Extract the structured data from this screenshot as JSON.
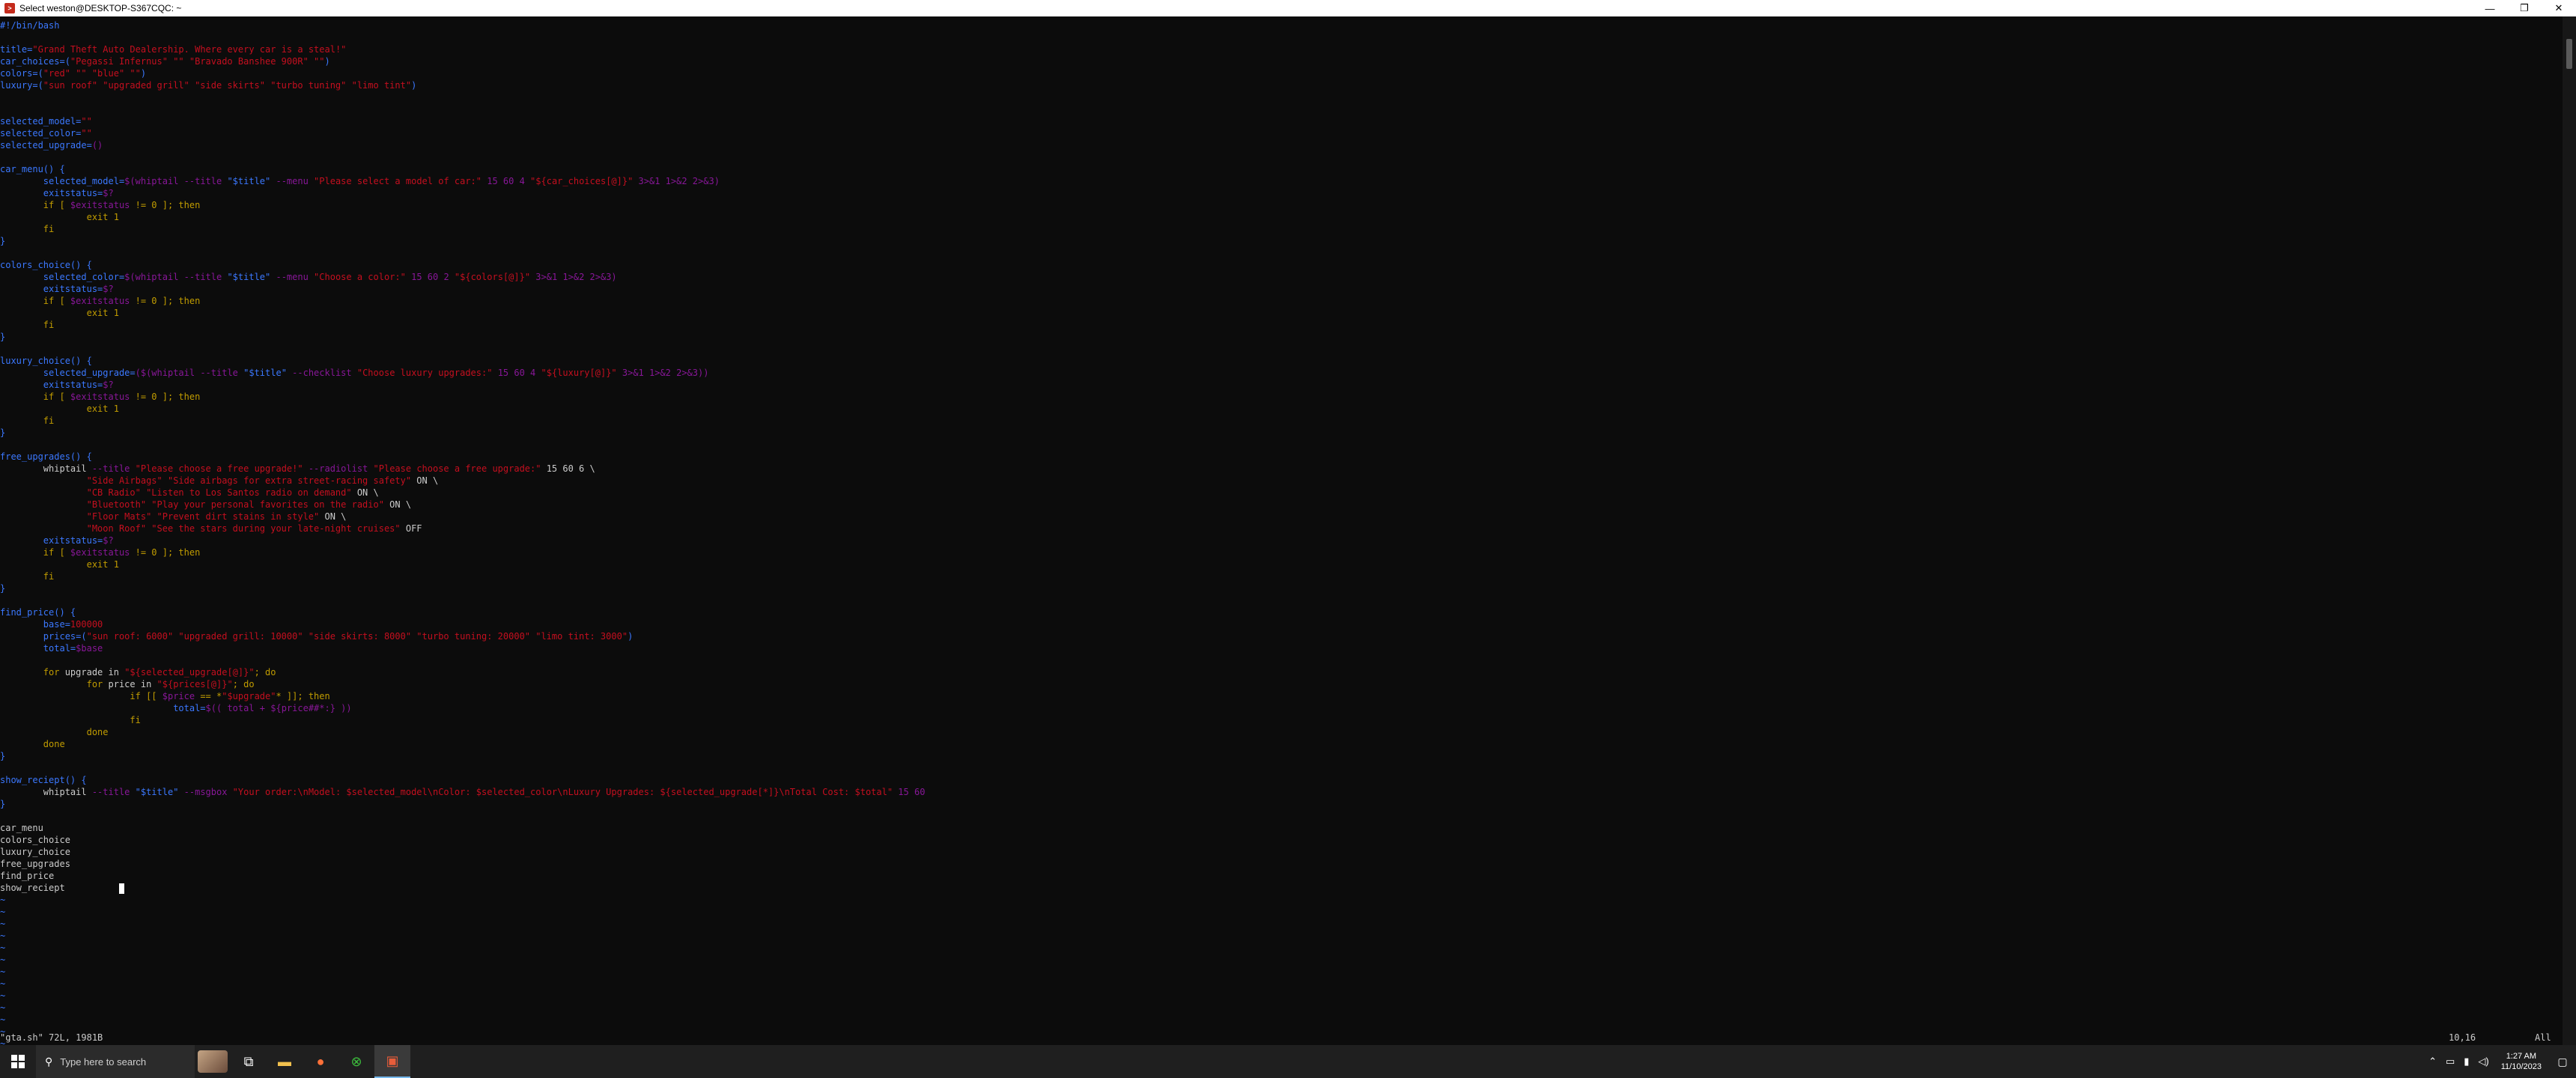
{
  "window": {
    "title": "Select weston@DESKTOP-S367CQC: ~",
    "controls": {
      "minimize": "—",
      "maximize": "❐",
      "close": "✕"
    }
  },
  "editor": {
    "lines": [
      [
        [
          "#!/bin/bash",
          "cmt"
        ]
      ],
      [
        [
          "",
          ""
        ]
      ],
      [
        [
          "title=",
          "var"
        ],
        [
          "\"Grand Theft Auto Dealership. Where every car is a steal!\"",
          "str"
        ]
      ],
      [
        [
          "car_choices=(",
          "var"
        ],
        [
          "\"Pegassi Infernus\" \"\" \"Bravado Banshee 900R\" \"\"",
          "str"
        ],
        [
          ")",
          "var"
        ]
      ],
      [
        [
          "colors=(",
          "var"
        ],
        [
          "\"red\" \"\" \"blue\" \"\"",
          "str"
        ],
        [
          ")",
          "var"
        ]
      ],
      [
        [
          "luxury=(",
          "var"
        ],
        [
          "\"sun roof\" \"upgraded grill\" \"side skirts\" \"turbo tuning\" \"limo tint\"",
          "str"
        ],
        [
          ")",
          "var"
        ]
      ],
      [
        [
          "",
          ""
        ]
      ],
      [
        [
          "",
          ""
        ]
      ],
      [
        [
          "selected_model=",
          "var"
        ],
        [
          "\"\"",
          "str"
        ]
      ],
      [
        [
          "selected_color=",
          "var"
        ],
        [
          "\"\"",
          "str"
        ]
      ],
      [
        [
          "selected_upgrade=",
          "var"
        ],
        [
          "()",
          "expr"
        ]
      ],
      [
        [
          "",
          ""
        ]
      ],
      [
        [
          "car_menu() {",
          "var"
        ]
      ],
      [
        [
          "        selected_model=",
          "var"
        ],
        [
          "$(whiptail --title ",
          "expr"
        ],
        [
          "\"$title\"",
          "var"
        ],
        [
          " --menu ",
          "expr"
        ],
        [
          "\"Please select a model of car:\"",
          "str"
        ],
        [
          " 15 60 4 ",
          "expr"
        ],
        [
          "\"${car_choices[@]}\"",
          "str"
        ],
        [
          " 3>&1 1>&2 2>&3)",
          "expr"
        ]
      ],
      [
        [
          "        exitstatus=",
          "var"
        ],
        [
          "$?",
          "expr"
        ]
      ],
      [
        [
          "        if [ ",
          "kw"
        ],
        [
          "$exitstatus",
          "expr"
        ],
        [
          " != 0 ]; then",
          "kw"
        ]
      ],
      [
        [
          "                exit 1",
          "kw"
        ]
      ],
      [
        [
          "        fi",
          "kw"
        ]
      ],
      [
        [
          "}",
          "var"
        ]
      ],
      [
        [
          "",
          ""
        ]
      ],
      [
        [
          "colors_choice() {",
          "var"
        ]
      ],
      [
        [
          "        selected_color=",
          "var"
        ],
        [
          "$(whiptail --title ",
          "expr"
        ],
        [
          "\"$title\"",
          "var"
        ],
        [
          " --menu ",
          "expr"
        ],
        [
          "\"Choose a color:\"",
          "str"
        ],
        [
          " 15 60 2 ",
          "expr"
        ],
        [
          "\"${colors[@]}\"",
          "str"
        ],
        [
          " 3>&1 1>&2 2>&3)",
          "expr"
        ]
      ],
      [
        [
          "        exitstatus=",
          "var"
        ],
        [
          "$?",
          "expr"
        ]
      ],
      [
        [
          "        if [ ",
          "kw"
        ],
        [
          "$exitstatus",
          "expr"
        ],
        [
          " != 0 ]; then",
          "kw"
        ]
      ],
      [
        [
          "                exit 1",
          "kw"
        ]
      ],
      [
        [
          "        fi",
          "kw"
        ]
      ],
      [
        [
          "}",
          "var"
        ]
      ],
      [
        [
          "",
          ""
        ]
      ],
      [
        [
          "luxury_choice() {",
          "var"
        ]
      ],
      [
        [
          "        selected_upgrade=",
          "var"
        ],
        [
          "($(whiptail --title ",
          "expr"
        ],
        [
          "\"$title\"",
          "var"
        ],
        [
          " --checklist ",
          "expr"
        ],
        [
          "\"Choose luxury upgrades:\"",
          "str"
        ],
        [
          " 15 60 4 ",
          "expr"
        ],
        [
          "\"${luxury[@]}\"",
          "str"
        ],
        [
          " 3>&1 1>&2 2>&3))",
          "expr"
        ]
      ],
      [
        [
          "        exitstatus=",
          "var"
        ],
        [
          "$?",
          "expr"
        ]
      ],
      [
        [
          "        if [ ",
          "kw"
        ],
        [
          "$exitstatus",
          "expr"
        ],
        [
          " != 0 ]; then",
          "kw"
        ]
      ],
      [
        [
          "                exit 1",
          "kw"
        ]
      ],
      [
        [
          "        fi",
          "kw"
        ]
      ],
      [
        [
          "}",
          "var"
        ]
      ],
      [
        [
          "",
          ""
        ]
      ],
      [
        [
          "free_upgrades() {",
          "var"
        ]
      ],
      [
        [
          "        whiptail ",
          ""
        ],
        [
          "--title ",
          "expr"
        ],
        [
          "\"Please choose a free upgrade!\"",
          "str"
        ],
        [
          " --radiolist ",
          "expr"
        ],
        [
          "\"Please choose a free upgrade:\"",
          "str"
        ],
        [
          " 15 60 6 \\",
          ""
        ]
      ],
      [
        [
          "                ",
          ""
        ],
        [
          "\"Side Airbags\" \"Side airbags for extra street-racing safety\"",
          "str"
        ],
        [
          " ON \\",
          ""
        ]
      ],
      [
        [
          "                ",
          ""
        ],
        [
          "\"CB Radio\" \"Listen to Los Santos radio on demand\"",
          "str"
        ],
        [
          " ON \\",
          ""
        ]
      ],
      [
        [
          "                ",
          ""
        ],
        [
          "\"Bluetooth\" \"Play your personal favorites on the radio\"",
          "str"
        ],
        [
          " ON \\",
          ""
        ]
      ],
      [
        [
          "                ",
          ""
        ],
        [
          "\"Floor Mats\" \"Prevent dirt stains in style\"",
          "str"
        ],
        [
          " ON \\",
          ""
        ]
      ],
      [
        [
          "                ",
          ""
        ],
        [
          "\"Moon Roof\" \"See the stars during your late-night cruises\"",
          "str"
        ],
        [
          " OFF",
          ""
        ]
      ],
      [
        [
          "        exitstatus=",
          "var"
        ],
        [
          "$?",
          "expr"
        ]
      ],
      [
        [
          "        if [ ",
          "kw"
        ],
        [
          "$exitstatus",
          "expr"
        ],
        [
          " != 0 ]; then",
          "kw"
        ]
      ],
      [
        [
          "                exit 1",
          "kw"
        ]
      ],
      [
        [
          "        fi",
          "kw"
        ]
      ],
      [
        [
          "}",
          "var"
        ]
      ],
      [
        [
          "",
          ""
        ]
      ],
      [
        [
          "find_price() {",
          "var"
        ]
      ],
      [
        [
          "        base=",
          "var"
        ],
        [
          "100000",
          "num"
        ]
      ],
      [
        [
          "        prices=(",
          "var"
        ],
        [
          "\"sun roof: 6000\" \"upgraded grill: 10000\" \"side skirts: 8000\" \"turbo tuning: 20000\" \"limo tint: 3000\"",
          "str"
        ],
        [
          ")",
          "var"
        ]
      ],
      [
        [
          "        total=",
          "var"
        ],
        [
          "$base",
          "expr"
        ]
      ],
      [
        [
          "",
          ""
        ]
      ],
      [
        [
          "        for ",
          "kw"
        ],
        [
          "upgrade in ",
          ""
        ],
        [
          "\"${selected_upgrade[@]}\"",
          "str"
        ],
        [
          "; do",
          "kw"
        ]
      ],
      [
        [
          "                for ",
          "kw"
        ],
        [
          "price in ",
          ""
        ],
        [
          "\"${prices[@]}\"",
          "str"
        ],
        [
          "; do",
          "kw"
        ]
      ],
      [
        [
          "                        if [[ ",
          "kw"
        ],
        [
          "$price",
          "expr"
        ],
        [
          " == *",
          "kw"
        ],
        [
          "\"$upgrade\"",
          "str"
        ],
        [
          "* ]]; then",
          "kw"
        ]
      ],
      [
        [
          "                                total=",
          "var"
        ],
        [
          "$(( total + ${price##*:} ))",
          "expr"
        ]
      ],
      [
        [
          "                        fi",
          "kw"
        ]
      ],
      [
        [
          "                done",
          "kw"
        ]
      ],
      [
        [
          "        done",
          "kw"
        ]
      ],
      [
        [
          "}",
          "var"
        ]
      ],
      [
        [
          "",
          ""
        ]
      ],
      [
        [
          "show_reciept() {",
          "var"
        ]
      ],
      [
        [
          "        whiptail ",
          ""
        ],
        [
          "--title ",
          "expr"
        ],
        [
          "\"$title\"",
          "var"
        ],
        [
          " --msgbox ",
          "expr"
        ],
        [
          "\"Your order:\\nModel: $selected_model\\nColor: $selected_color\\nLuxury Upgrades: ${selected_upgrade[*]}\\nTotal Cost: $total\"",
          "str"
        ],
        [
          " 15 60",
          "expr"
        ]
      ],
      [
        [
          "}",
          "var"
        ]
      ],
      [
        [
          "",
          ""
        ]
      ],
      [
        [
          "car_menu",
          ""
        ]
      ],
      [
        [
          "colors_choice",
          ""
        ]
      ],
      [
        [
          "luxury_choice",
          ""
        ]
      ],
      [
        [
          "free_upgrades",
          ""
        ]
      ],
      [
        [
          "find_price",
          ""
        ]
      ],
      [
        [
          "show_reciept",
          ""
        ]
      ]
    ],
    "tilde_count": 14,
    "tilde_char": "~"
  },
  "vim_status": {
    "file_info": "\"gta.sh\" 72L, 1981B",
    "position": "10,16",
    "scroll": "All"
  },
  "taskbar": {
    "search_placeholder": "Type here to search",
    "time": "1:27 AM",
    "date": "11/10/2023"
  }
}
